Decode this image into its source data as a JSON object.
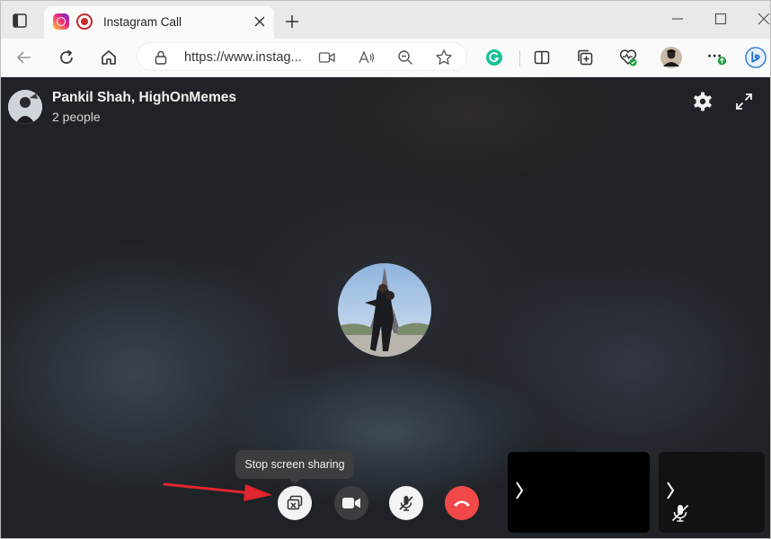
{
  "browser": {
    "tab": {
      "title": "Instagram Call"
    },
    "address": {
      "url": "https://www.instag..."
    }
  },
  "call": {
    "header": {
      "title": "Pankil Shah, HighOnMemes",
      "subtitle": "2 people"
    },
    "tooltip": "Stop screen sharing"
  },
  "colors": {
    "hangup": "#f14848",
    "tooltip_bg": "#3c3d40",
    "annotation_arrow": "#e0262e"
  }
}
